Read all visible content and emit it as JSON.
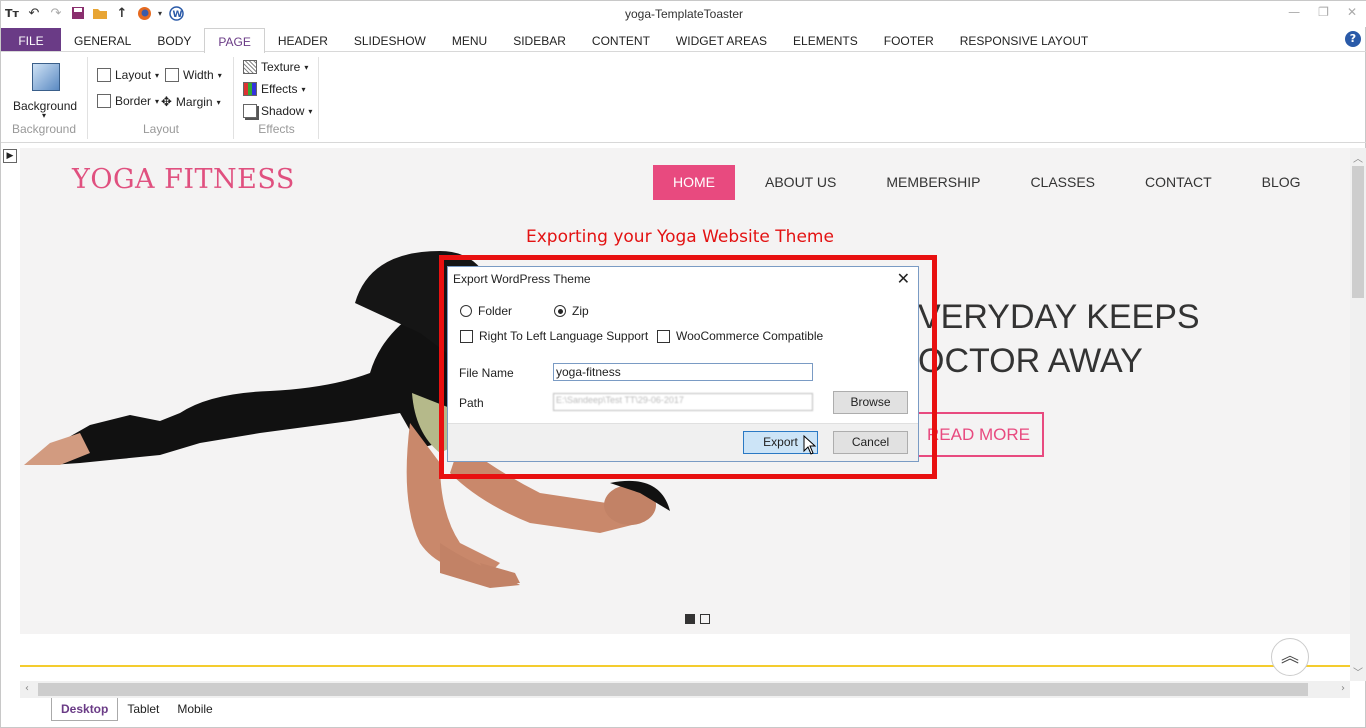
{
  "app": {
    "title": "yoga-TemplateToaster",
    "tabs": [
      "FILE",
      "GENERAL",
      "BODY",
      "PAGE",
      "HEADER",
      "SLIDESHOW",
      "MENU",
      "SIDEBAR",
      "CONTENT",
      "WIDGET AREAS",
      "ELEMENTS",
      "FOOTER",
      "RESPONSIVE LAYOUT"
    ],
    "active_tab": "PAGE",
    "help": "?"
  },
  "ribbon": {
    "background_group": {
      "button": "Background",
      "label": "Background"
    },
    "layout_group": {
      "layout": "Layout",
      "width": "Width",
      "border": "Border",
      "margin": "Margin",
      "label": "Layout"
    },
    "effects_group": {
      "texture": "Texture",
      "effects": "Effects",
      "shadow": "Shadow",
      "label": "Effects"
    }
  },
  "site": {
    "logo": "YOGA FITNESS",
    "nav": [
      "HOME",
      "ABOUT US",
      "MEMBERSHIP",
      "CLASSES",
      "CONTACT",
      "BLOG"
    ],
    "nav_active": "HOME",
    "hero_line1": "VERYDAY KEEPS",
    "hero_line2": "OCTOR AWAY",
    "read_more": "READ MORE",
    "accent_color": "#e84a7f"
  },
  "annotation": "Exporting your Yoga Website Theme",
  "dialog": {
    "title": "Export WordPress Theme",
    "folder_label": "Folder",
    "zip_label": "Zip",
    "selected": "Zip",
    "rtl_label": "Right To Left Language Support",
    "woo_label": "WooCommerce Compatible",
    "file_name_label": "File Name",
    "file_name_value": "yoga-fitness",
    "path_label": "Path",
    "path_value": "E:\\Sandeep\\Test TT\\29-06-2017",
    "browse": "Browse",
    "export": "Export",
    "cancel": "Cancel"
  },
  "view_tabs": [
    "Desktop",
    "Tablet",
    "Mobile"
  ],
  "active_view": "Desktop"
}
